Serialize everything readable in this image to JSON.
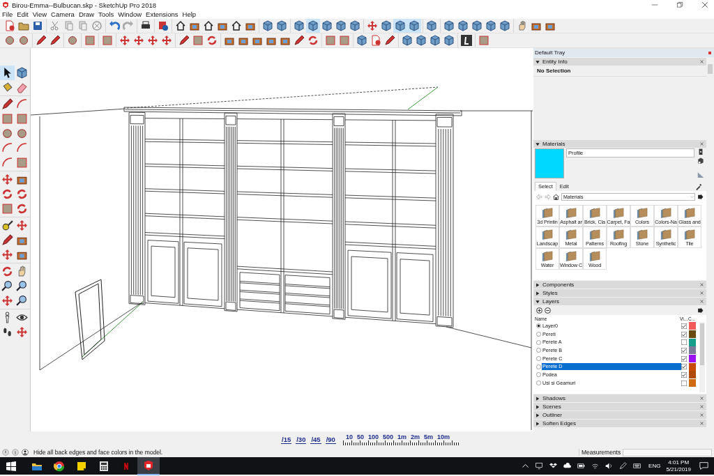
{
  "window": {
    "title": "Birou-Emma--Bulbucan.skp - SketchUp Pro 2018"
  },
  "menu": [
    "File",
    "Edit",
    "View",
    "Camera",
    "Draw",
    "Tools",
    "Window",
    "Extensions",
    "Help"
  ],
  "toolbars": [
    {
      "groups": [
        [
          {
            "kind": "doc",
            "on": false
          },
          {
            "kind": "folder",
            "on": false
          },
          {
            "kind": "save",
            "on": false
          }
        ],
        [
          {
            "kind": "scissors",
            "on": false
          },
          {
            "kind": "copy",
            "on": false
          },
          {
            "kind": "copy",
            "on": false
          },
          {
            "kind": "cross",
            "on": false
          }
        ],
        [
          {
            "kind": "undo",
            "on": false
          },
          {
            "kind": "redo",
            "on": false
          }
        ],
        [
          {
            "kind": "printer",
            "on": false
          }
        ],
        [
          {
            "kind": "info",
            "on": false
          }
        ],
        [
          {
            "kind": "house",
            "on": false
          },
          {
            "kind": "box",
            "on": false
          },
          {
            "kind": "house",
            "on": false
          },
          {
            "kind": "box",
            "on": false
          },
          {
            "kind": "house",
            "on": false
          },
          {
            "kind": "box",
            "on": false
          }
        ],
        [
          {
            "kind": "cube",
            "on": false
          },
          {
            "kind": "cube",
            "on": false
          }
        ],
        [
          {
            "kind": "cube",
            "on": false
          },
          {
            "kind": "cube",
            "on": true
          },
          {
            "kind": "cube",
            "on": false
          },
          {
            "kind": "cube",
            "on": false
          },
          {
            "kind": "cube",
            "on": false
          }
        ],
        [
          {
            "kind": "arrow",
            "on": false
          },
          {
            "kind": "cube",
            "on": false
          },
          {
            "kind": "cube",
            "on": true
          },
          {
            "kind": "cube",
            "on": true
          }
        ],
        [
          {
            "kind": "cube",
            "on": false
          }
        ],
        [
          {
            "kind": "cube",
            "on": false
          },
          {
            "kind": "cube",
            "on": false
          },
          {
            "kind": "cube",
            "on": false
          },
          {
            "kind": "cube",
            "on": false
          },
          {
            "kind": "cube",
            "on": false
          }
        ],
        [
          {
            "kind": "hand",
            "on": false
          },
          {
            "kind": "box",
            "on": false
          },
          {
            "kind": "box",
            "on": false
          }
        ]
      ]
    },
    {
      "groups": [
        [
          {
            "kind": "dot",
            "on": false
          },
          {
            "kind": "dot",
            "on": false
          }
        ],
        [
          {
            "kind": "pencil",
            "on": false
          },
          {
            "kind": "pencil",
            "on": false
          }
        ],
        [
          {
            "kind": "dot",
            "on": false
          }
        ],
        [
          {
            "kind": "square",
            "on": false
          }
        ],
        [
          {
            "kind": "square",
            "on": false
          }
        ],
        [
          {
            "kind": "arrow",
            "on": false
          },
          {
            "kind": "arrow",
            "on": false
          },
          {
            "kind": "arrow",
            "on": false
          },
          {
            "kind": "arrow",
            "on": false
          }
        ],
        [
          {
            "kind": "pencil",
            "on": false
          },
          {
            "kind": "square",
            "on": false
          },
          {
            "kind": "rotate",
            "on": false
          }
        ],
        [
          {
            "kind": "box",
            "on": false
          },
          {
            "kind": "box",
            "on": false
          },
          {
            "kind": "box",
            "on": false
          },
          {
            "kind": "box",
            "on": false
          },
          {
            "kind": "box",
            "on": false
          },
          {
            "kind": "pencil",
            "on": false
          },
          {
            "kind": "rotate",
            "on": false
          }
        ],
        [
          {
            "kind": "square",
            "on": false
          },
          {
            "kind": "square",
            "on": false
          }
        ],
        [
          {
            "kind": "cube",
            "on": false
          },
          {
            "kind": "doc",
            "on": false
          },
          {
            "kind": "pencil",
            "on": false
          }
        ],
        [
          {
            "kind": "cube",
            "on": false
          },
          {
            "kind": "cube",
            "on": false
          },
          {
            "kind": "cube",
            "on": false
          },
          {
            "kind": "cube",
            "on": false
          }
        ],
        [
          {
            "kind": "logo",
            "on": false
          }
        ],
        [
          {
            "kind": "square",
            "on": false
          }
        ]
      ]
    }
  ],
  "tools": {
    "groups": [
      [
        {
          "kind": "pointer",
          "on": true
        },
        {
          "kind": "cube",
          "on": false
        },
        {
          "kind": "paint",
          "on": false
        },
        {
          "kind": "eraser",
          "on": false
        }
      ],
      [
        {
          "kind": "pencil",
          "on": false
        },
        {
          "kind": "arc",
          "on": false
        },
        {
          "kind": "square",
          "on": false
        },
        {
          "kind": "square",
          "on": false
        },
        {
          "kind": "dot",
          "on": false
        },
        {
          "kind": "dot",
          "on": false
        },
        {
          "kind": "arc",
          "on": false
        },
        {
          "kind": "arc",
          "on": false
        },
        {
          "kind": "arc",
          "on": false
        },
        {
          "kind": "square",
          "on": false
        }
      ],
      [
        {
          "kind": "arrow",
          "on": false
        },
        {
          "kind": "box",
          "on": false
        },
        {
          "kind": "rotate",
          "on": false
        },
        {
          "kind": "rotate",
          "on": false
        },
        {
          "kind": "square",
          "on": false
        },
        {
          "kind": "rotate",
          "on": false
        }
      ],
      [
        {
          "kind": "tape",
          "on": false
        },
        {
          "kind": "arrow",
          "on": false
        },
        {
          "kind": "pencil",
          "on": false
        },
        {
          "kind": "box",
          "on": false
        },
        {
          "kind": "arrow",
          "on": false
        },
        {
          "kind": "box",
          "on": false
        }
      ],
      [
        {
          "kind": "rotate",
          "on": false
        },
        {
          "kind": "hand",
          "on": false
        },
        {
          "kind": "zoom",
          "on": false
        },
        {
          "kind": "zoom",
          "on": false
        },
        {
          "kind": "arrow",
          "on": false
        },
        {
          "kind": "zoom",
          "on": false
        }
      ],
      [
        {
          "kind": "person",
          "on": false
        },
        {
          "kind": "eye",
          "on": false
        },
        {
          "kind": "feet",
          "on": false
        },
        {
          "kind": "arrow",
          "on": false
        }
      ]
    ]
  },
  "tray": {
    "title": "Default Tray",
    "panels": [
      {
        "kind": "entity",
        "title": "Entity Info",
        "expanded": true,
        "status": "No Selection"
      },
      {
        "kind": "materials",
        "title": "Materials",
        "expanded": true,
        "name": "Profile",
        "color": "#00d8ff",
        "tabs": [
          {
            "label": "Select",
            "selected": true
          },
          {
            "label": "Edit",
            "selected": false
          }
        ],
        "collection": "Materials",
        "items": [
          {
            "label": "3d Printin"
          },
          {
            "label": "Asphalt ar"
          },
          {
            "label": "Brick, Cla"
          },
          {
            "label": "Carpet, Fa"
          },
          {
            "label": "Colors"
          },
          {
            "label": "Colors-Na"
          },
          {
            "label": "Glass and"
          },
          {
            "label": "Landscap"
          },
          {
            "label": "Metal"
          },
          {
            "label": "Patterns"
          },
          {
            "label": "Roofing"
          },
          {
            "label": "Stone"
          },
          {
            "label": "Synthetic"
          },
          {
            "label": "Tile"
          },
          {
            "label": "Water"
          },
          {
            "label": "Window C"
          },
          {
            "label": "Wood"
          }
        ]
      },
      {
        "kind": "plain",
        "title": "Components",
        "expanded": false
      },
      {
        "kind": "plain",
        "title": "Styles",
        "expanded": false
      },
      {
        "kind": "layers",
        "title": "Layers",
        "expanded": true,
        "columns": [
          "Name",
          "Vi...",
          "C..."
        ],
        "rows": [
          {
            "name": "Layer0",
            "current": true,
            "visible": true,
            "color": "#f25a5a",
            "selected": false
          },
          {
            "name": "Pereti",
            "current": false,
            "visible": true,
            "color": "#6b4a10",
            "selected": false
          },
          {
            "name": "Perete A",
            "current": false,
            "visible": false,
            "color": "#159e8c",
            "selected": false
          },
          {
            "name": "Perete B",
            "current": false,
            "visible": true,
            "color": "#7a7a9a",
            "selected": false
          },
          {
            "name": "Perete C",
            "current": false,
            "visible": true,
            "color": "#9a10f0",
            "selected": false
          },
          {
            "name": "Perete D",
            "current": false,
            "visible": true,
            "color": "#c84a08",
            "selected": true
          },
          {
            "name": "Podea",
            "current": false,
            "visible": true,
            "color": "#b04a08",
            "selected": false
          },
          {
            "name": "Usi si Geamuri",
            "current": false,
            "visible": false,
            "color": "#d06a10",
            "selected": false
          }
        ]
      },
      {
        "kind": "plain",
        "title": "Shadows",
        "expanded": false
      },
      {
        "kind": "plain",
        "title": "Scenes",
        "expanded": false
      },
      {
        "kind": "plain",
        "title": "Outliner",
        "expanded": false
      },
      {
        "kind": "plain",
        "title": "Soften Edges",
        "expanded": false
      }
    ]
  },
  "scale_bar": {
    "angles": [
      "/15",
      "/30",
      "/45",
      "/90"
    ],
    "lengths": [
      "10",
      "50",
      "100",
      "500",
      "1m",
      "2m",
      "5m",
      "10m"
    ]
  },
  "status_bar": {
    "message": "Hide all back edges and face colors in the model.",
    "measurements_label": "Measurements"
  },
  "taskbar": {
    "apps": [
      {
        "kind": "explorer",
        "active": false
      },
      {
        "kind": "browser",
        "active": false
      },
      {
        "kind": "notes",
        "active": false
      },
      {
        "kind": "calculator",
        "active": false
      },
      {
        "kind": "video",
        "active": false
      },
      {
        "kind": "sketchup",
        "active": true
      }
    ],
    "language": "ENG",
    "time": "4:01 PM",
    "date": "5/21/2019"
  }
}
